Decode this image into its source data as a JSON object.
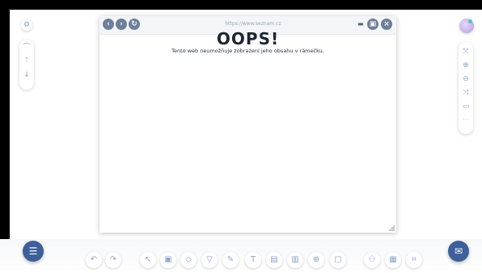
{
  "browser": {
    "url": "https://www.seznam.cz",
    "error_title": "OOPS!",
    "error_message": "Tento web neumožňuje zobrazení jeho obsahu v rámečku."
  },
  "icons": {
    "back": "chevron-left",
    "forward": "chevron-right",
    "reload": "reload",
    "keyboard": "keyboard",
    "pin": "pin",
    "close": "close"
  }
}
